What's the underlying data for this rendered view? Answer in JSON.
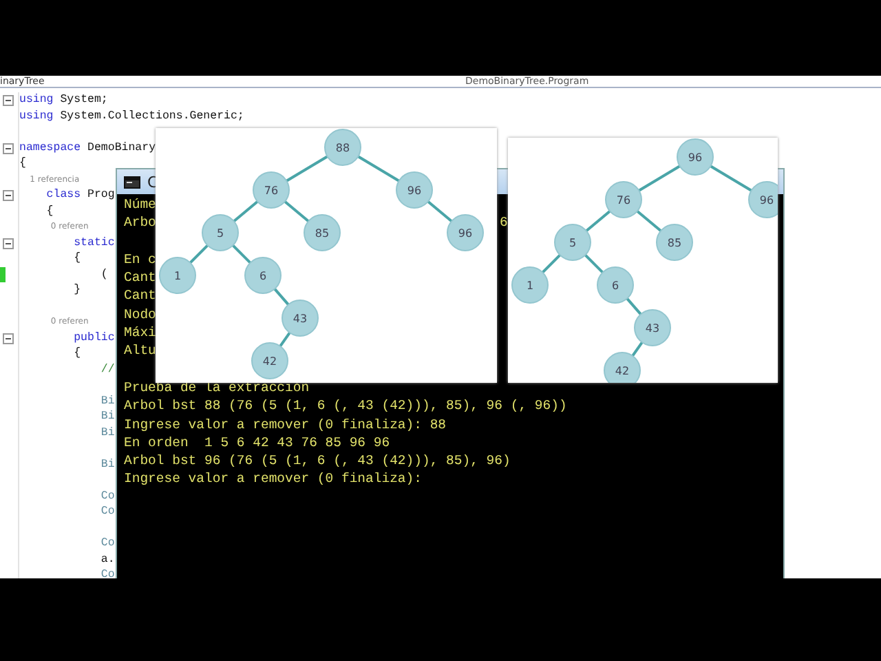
{
  "tabs": [
    {
      "label": "inaryTree",
      "selected": true
    },
    {
      "label": "DemoBinaryTree.Program",
      "selected": false
    }
  ],
  "code": [
    {
      "kind": "code",
      "foldable": true,
      "changed": false,
      "segments": [
        {
          "kind": "keyword",
          "text": "using"
        },
        {
          "kind": "text",
          "text": " System;"
        }
      ]
    },
    {
      "kind": "code",
      "foldable": false,
      "changed": false,
      "segments": [
        {
          "kind": "keyword",
          "text": "using"
        },
        {
          "kind": "text",
          "text": " System.Collections.Generic;"
        }
      ]
    },
    {
      "kind": "blank"
    },
    {
      "kind": "code",
      "foldable": true,
      "changed": false,
      "segments": [
        {
          "kind": "keyword",
          "text": "namespace"
        },
        {
          "kind": "text",
          "text": " DemoBinary"
        }
      ]
    },
    {
      "kind": "code",
      "foldable": false,
      "changed": false,
      "segments": [
        {
          "kind": "text",
          "text": "{"
        }
      ]
    },
    {
      "kind": "code",
      "foldable": false,
      "changed": false,
      "segments": [
        {
          "kind": "hint",
          "text": "    1 referencia"
        }
      ]
    },
    {
      "kind": "code",
      "foldable": true,
      "changed": false,
      "segments": [
        {
          "kind": "keyword",
          "text": "    class"
        },
        {
          "kind": "text",
          "text": " Prog"
        }
      ]
    },
    {
      "kind": "code",
      "foldable": false,
      "changed": false,
      "segments": [
        {
          "kind": "text",
          "text": "    {"
        }
      ]
    },
    {
      "kind": "code",
      "foldable": false,
      "changed": false,
      "segments": [
        {
          "kind": "hint",
          "text": "            0 referen"
        }
      ]
    },
    {
      "kind": "code",
      "foldable": true,
      "changed": false,
      "segments": [
        {
          "kind": "keyword",
          "text": "        static"
        }
      ]
    },
    {
      "kind": "code",
      "foldable": false,
      "changed": false,
      "segments": [
        {
          "kind": "text",
          "text": "        {"
        }
      ]
    },
    {
      "kind": "code",
      "foldable": false,
      "changed": true,
      "segments": [
        {
          "kind": "text",
          "text": "            ("
        }
      ]
    },
    {
      "kind": "code",
      "foldable": false,
      "changed": false,
      "segments": [
        {
          "kind": "text",
          "text": "        }"
        }
      ]
    },
    {
      "kind": "blank"
    },
    {
      "kind": "code",
      "foldable": false,
      "changed": false,
      "segments": [
        {
          "kind": "hint",
          "text": "            0 referen"
        }
      ]
    },
    {
      "kind": "code",
      "foldable": true,
      "changed": false,
      "segments": [
        {
          "kind": "keyword",
          "text": "        public"
        }
      ]
    },
    {
      "kind": "code",
      "foldable": false,
      "changed": false,
      "segments": [
        {
          "kind": "text",
          "text": "        {"
        }
      ]
    },
    {
      "kind": "code",
      "foldable": false,
      "changed": false,
      "segments": [
        {
          "kind": "comment",
          "text": "            //"
        }
      ]
    },
    {
      "kind": "blank"
    },
    {
      "kind": "code",
      "foldable": false,
      "changed": false,
      "segments": [
        {
          "kind": "type",
          "text": "            Bi"
        }
      ]
    },
    {
      "kind": "code",
      "foldable": false,
      "changed": false,
      "segments": [
        {
          "kind": "type",
          "text": "            Bi"
        }
      ]
    },
    {
      "kind": "code",
      "foldable": false,
      "changed": false,
      "segments": [
        {
          "kind": "type",
          "text": "            Bi"
        }
      ]
    },
    {
      "kind": "blank"
    },
    {
      "kind": "code",
      "foldable": false,
      "changed": false,
      "segments": [
        {
          "kind": "type",
          "text": "            Bi"
        }
      ]
    },
    {
      "kind": "blank"
    },
    {
      "kind": "code",
      "foldable": false,
      "changed": false,
      "segments": [
        {
          "kind": "type",
          "text": "            Co"
        }
      ]
    },
    {
      "kind": "code",
      "foldable": false,
      "changed": false,
      "segments": [
        {
          "kind": "type",
          "text": "            Co"
        }
      ]
    },
    {
      "kind": "blank"
    },
    {
      "kind": "code",
      "foldable": false,
      "changed": false,
      "segments": [
        {
          "kind": "type",
          "text": "            Co"
        }
      ]
    },
    {
      "kind": "code",
      "foldable": false,
      "changed": false,
      "segments": [
        {
          "kind": "text",
          "text": "            a."
        }
      ]
    },
    {
      "kind": "code",
      "foldable": false,
      "changed": false,
      "segments": [
        {
          "kind": "type",
          "text": "            Co"
        }
      ]
    }
  ],
  "console": {
    "title": "C",
    "lines": [
      {
        "kind": "text",
        "text": "Núme"
      },
      {
        "kind": "text",
        "text": "Arbo",
        "tail": "6"
      },
      {
        "kind": "blank"
      },
      {
        "kind": "text",
        "text": "En c"
      },
      {
        "kind": "text",
        "text": "Cant"
      },
      {
        "kind": "text",
        "text": "Cant"
      },
      {
        "kind": "text",
        "text": "Nodo"
      },
      {
        "kind": "text",
        "text": "Máxi"
      },
      {
        "kind": "text",
        "text": "Altu"
      },
      {
        "kind": "blank"
      },
      {
        "kind": "text",
        "text": "Prueba de la extracción"
      },
      {
        "kind": "text",
        "text": "Arbol bst 88 (76 (5 (1, 6 (, 43 (42))), 85), 96 (, 96))"
      },
      {
        "kind": "text",
        "text": "Ingrese valor a remover (0 finaliza): 88"
      },
      {
        "kind": "text",
        "text": "En orden  1 5 6 42 43 76 85 96 96"
      },
      {
        "kind": "text",
        "text": "Arbol bst 96 (76 (5 (1, 6 (, 43 (42))), 85), 96)"
      },
      {
        "kind": "text",
        "text": "Ingrese valor a remover (0 finaliza):"
      }
    ]
  },
  "diagrams": [
    {
      "tree": {
        "label": "88",
        "left": {
          "label": "76",
          "left": {
            "label": "5",
            "left": {
              "label": "1"
            },
            "right": {
              "label": "6",
              "right": {
                "label": "43",
                "left": {
                  "label": "42"
                }
              }
            }
          },
          "right": {
            "label": "85"
          }
        },
        "right": {
          "label": "96",
          "right": {
            "label": "96"
          }
        }
      }
    },
    {
      "tree": {
        "label": "96",
        "left": {
          "label": "76",
          "left": {
            "label": "5",
            "left": {
              "label": "1"
            },
            "right": {
              "label": "6",
              "right": {
                "label": "43",
                "left": {
                  "label": "42"
                }
              }
            }
          },
          "right": {
            "label": "85"
          }
        },
        "right": {
          "label": "96"
        }
      }
    }
  ]
}
